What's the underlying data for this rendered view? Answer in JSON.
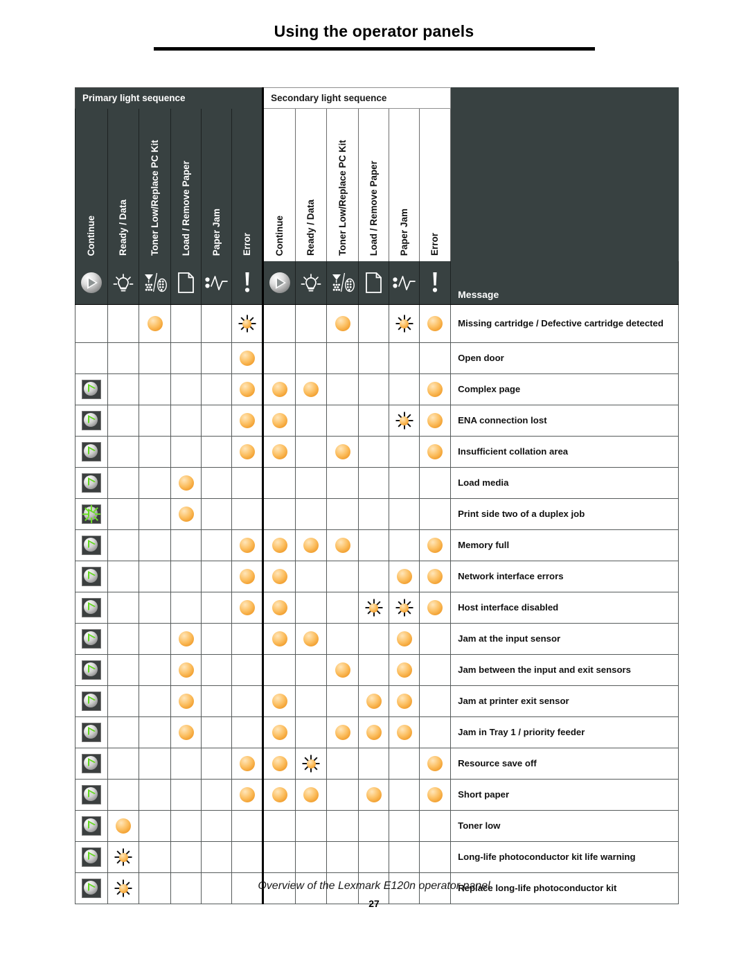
{
  "page": {
    "title": "Using the operator panels",
    "footer_caption": "Overview of the Lexmark E120n operator panel",
    "page_number": "27"
  },
  "table": {
    "band_headers": {
      "primary": "Primary light sequence",
      "secondary": "Secondary light sequence"
    },
    "message_header": "Message",
    "light_columns": [
      {
        "key": "continue",
        "label": "Continue",
        "icon": "continue-button-icon"
      },
      {
        "key": "ready",
        "label": "Ready / Data",
        "icon": "lightbulb-icon"
      },
      {
        "key": "toner",
        "label": "Toner Low/Replace PC Kit",
        "icon": "toner-pc-kit-icon"
      },
      {
        "key": "load",
        "label": "Load / Remove Paper",
        "icon": "paper-sheet-icon"
      },
      {
        "key": "jam",
        "label": "Paper Jam",
        "icon": "paper-jam-icon"
      },
      {
        "key": "error",
        "label": "Error",
        "icon": "exclamation-icon"
      }
    ],
    "legend": {
      "on": "light-on-indicator",
      "blink": "light-blinking-indicator",
      "continue_on": "continue-light-on",
      "continue_blink": "continue-light-blinking",
      "off": ""
    },
    "colors": {
      "header_bg": "#384141",
      "light_amber": "#f7b03f",
      "continue_green": "#5fd41f",
      "grid_line": "#555a5a",
      "section_divider": "#000000"
    },
    "rows": [
      {
        "message": "Missing cartridge / Defective cartridge detected",
        "primary": [
          "",
          "",
          "on",
          "",
          "",
          "blink"
        ],
        "secondary": [
          "",
          "",
          "on",
          "",
          "blink",
          "on"
        ]
      },
      {
        "message": "Open door",
        "primary": [
          "",
          "",
          "",
          "",
          "",
          "on"
        ],
        "secondary": [
          "",
          "",
          "",
          "",
          "",
          ""
        ]
      },
      {
        "message": "Complex page",
        "primary": [
          "cont-on",
          "",
          "",
          "",
          "",
          "on"
        ],
        "secondary": [
          "on",
          "on",
          "",
          "",
          "",
          "on"
        ]
      },
      {
        "message": "ENA connection lost",
        "primary": [
          "cont-on",
          "",
          "",
          "",
          "",
          "on"
        ],
        "secondary": [
          "on",
          "",
          "",
          "",
          "blink",
          "on"
        ]
      },
      {
        "message": "Insufficient collation area",
        "primary": [
          "cont-on",
          "",
          "",
          "",
          "",
          "on"
        ],
        "secondary": [
          "on",
          "",
          "on",
          "",
          "",
          "on"
        ]
      },
      {
        "message": "Load media",
        "primary": [
          "cont-on",
          "",
          "",
          "on",
          "",
          ""
        ],
        "secondary": [
          "",
          "",
          "",
          "",
          "",
          ""
        ]
      },
      {
        "message": "Print side two of a duplex job",
        "primary": [
          "cont-blink",
          "",
          "",
          "on",
          "",
          ""
        ],
        "secondary": [
          "",
          "",
          "",
          "",
          "",
          ""
        ]
      },
      {
        "message": "Memory full",
        "primary": [
          "cont-on",
          "",
          "",
          "",
          "",
          "on"
        ],
        "secondary": [
          "on",
          "on",
          "on",
          "",
          "",
          "on"
        ]
      },
      {
        "message": "Network interface errors",
        "primary": [
          "cont-on",
          "",
          "",
          "",
          "",
          "on"
        ],
        "secondary": [
          "on",
          "",
          "",
          "",
          "on",
          "on"
        ]
      },
      {
        "message": "Host interface disabled",
        "primary": [
          "cont-on",
          "",
          "",
          "",
          "",
          "on"
        ],
        "secondary": [
          "on",
          "",
          "",
          "blink",
          "blink",
          "on"
        ]
      },
      {
        "message": "Jam at the input sensor",
        "primary": [
          "cont-on",
          "",
          "",
          "on",
          "",
          ""
        ],
        "secondary": [
          "on",
          "on",
          "",
          "",
          "on",
          ""
        ]
      },
      {
        "message": "Jam between the input and exit sensors",
        "primary": [
          "cont-on",
          "",
          "",
          "on",
          "",
          ""
        ],
        "secondary": [
          "",
          "",
          "on",
          "",
          "on",
          ""
        ]
      },
      {
        "message": "Jam at printer exit sensor",
        "primary": [
          "cont-on",
          "",
          "",
          "on",
          "",
          ""
        ],
        "secondary": [
          "on",
          "",
          "",
          "on",
          "on",
          ""
        ]
      },
      {
        "message": "Jam in Tray 1 / priority feeder",
        "primary": [
          "cont-on",
          "",
          "",
          "on",
          "",
          ""
        ],
        "secondary": [
          "on",
          "",
          "on",
          "on",
          "on",
          ""
        ]
      },
      {
        "message": "Resource save off",
        "primary": [
          "cont-on",
          "",
          "",
          "",
          "",
          "on"
        ],
        "secondary": [
          "on",
          "blink",
          "",
          "",
          "",
          "on"
        ]
      },
      {
        "message": "Short paper",
        "primary": [
          "cont-on",
          "",
          "",
          "",
          "",
          "on"
        ],
        "secondary": [
          "on",
          "on",
          "",
          "on",
          "",
          "on"
        ]
      },
      {
        "message": "Toner low",
        "primary": [
          "cont-on",
          "on",
          "",
          "",
          "",
          ""
        ],
        "secondary": [
          "",
          "",
          "",
          "",
          "",
          ""
        ]
      },
      {
        "message": "Long-life photoconductor kit life warning",
        "primary": [
          "cont-on",
          "blink",
          "",
          "",
          "",
          ""
        ],
        "secondary": [
          "",
          "",
          "",
          "",
          "",
          ""
        ]
      },
      {
        "message": "Replace long-life photoconductor kit",
        "primary": [
          "cont-on",
          "blink",
          "",
          "",
          "",
          ""
        ],
        "secondary": [
          "",
          "",
          "",
          "",
          "",
          ""
        ]
      }
    ]
  }
}
